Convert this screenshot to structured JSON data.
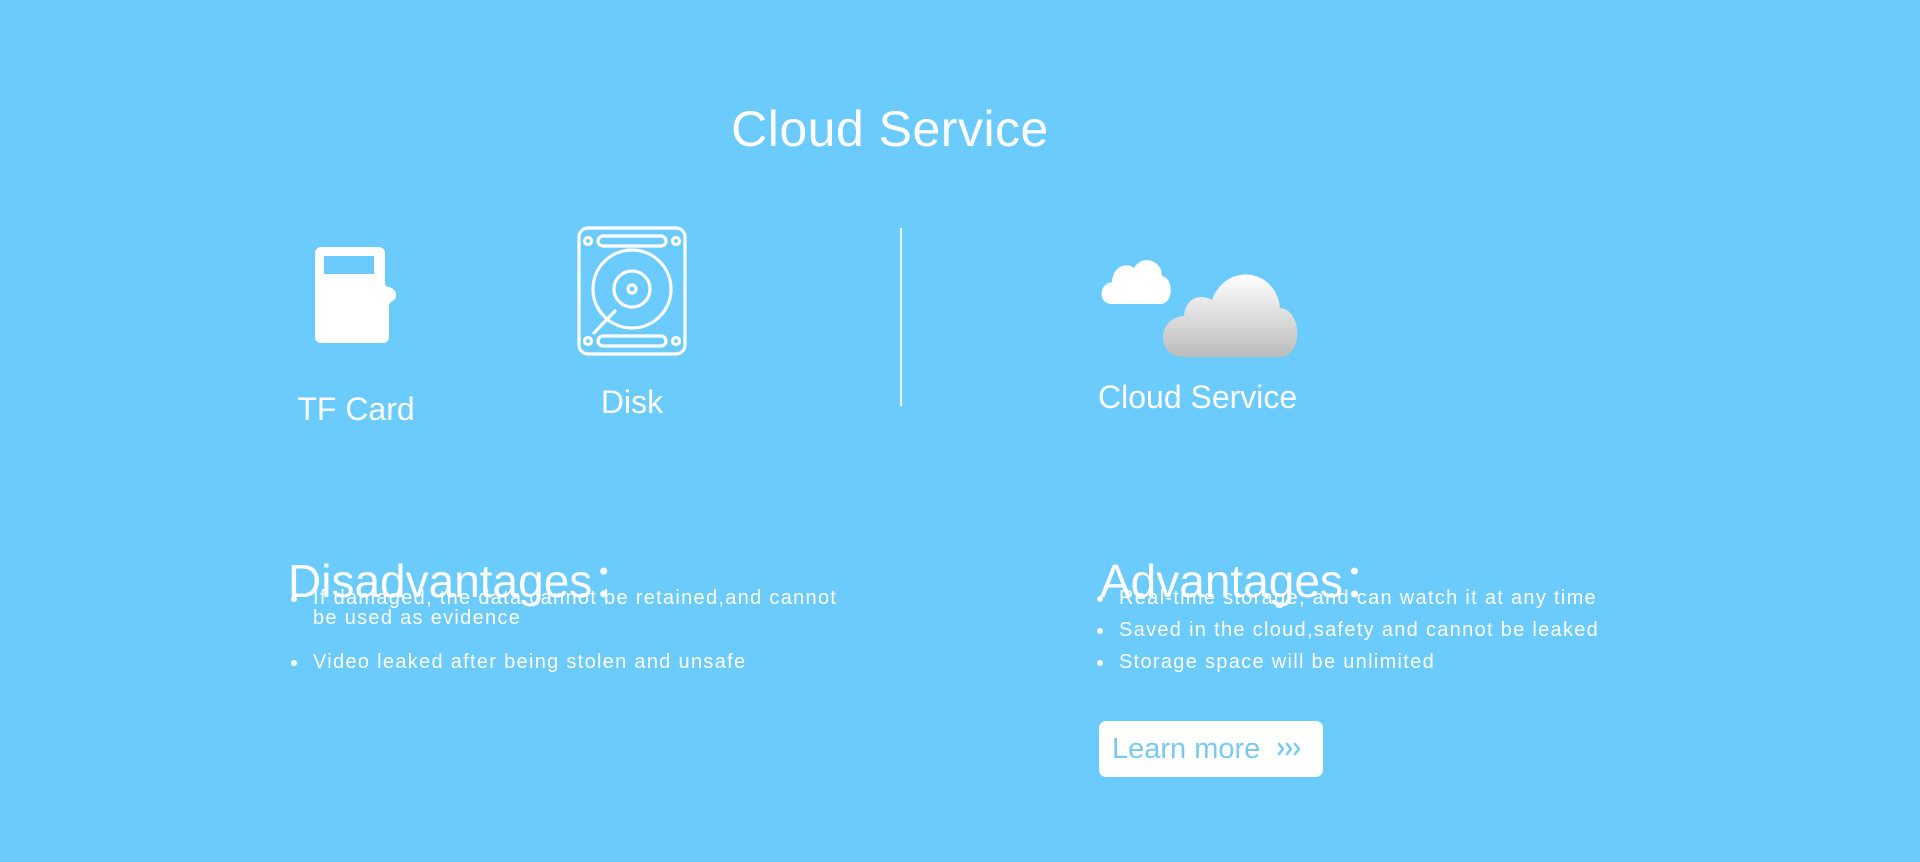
{
  "page": {
    "title": "Cloud Service"
  },
  "storage_options": {
    "tf_card": {
      "label": "TF Card",
      "icon": "tf-card-icon"
    },
    "disk": {
      "label": "Disk",
      "icon": "hard-disk-icon"
    },
    "cloud": {
      "label": "Cloud Service",
      "icon": "cloud-icon"
    }
  },
  "disadvantages": {
    "heading": "Disadvantages：",
    "points": [
      "If damaged, the data cannot be retained,and cannot be used as evidence",
      "Video leaked after being stolen and unsafe"
    ]
  },
  "advantages": {
    "heading": "Advantages：",
    "points": [
      "Real-time storage, and can watch it at any time",
      "Saved in the cloud,safety and cannot be leaked",
      "Storage space will be unlimited"
    ]
  },
  "cta": {
    "label": "Learn more",
    "icon": "triple-chevron-right-icon"
  },
  "colors": {
    "background": "#6bcbfd",
    "foreground": "#ffffff",
    "button_text": "#7cc9ef"
  }
}
